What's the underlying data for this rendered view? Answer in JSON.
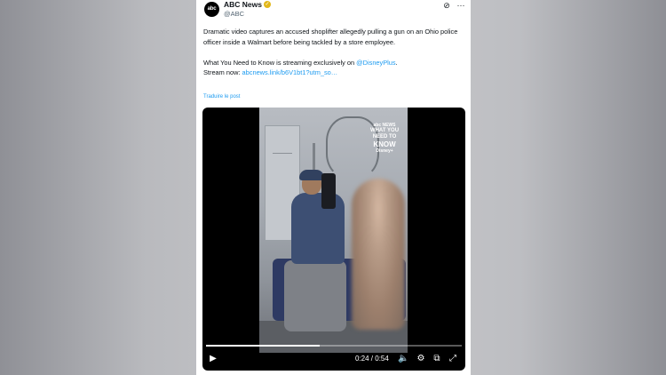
{
  "account": {
    "avatar_text": "abc",
    "avatar_sub": "NEWS",
    "name": "ABC News",
    "verified_glyph": "✓",
    "handle": "@ABC"
  },
  "header_icons": [
    "grok-icon",
    "more-icon"
  ],
  "tweet": {
    "line1": "Dramatic video captures an accused shoplifter allegedly pulling a gun on an Ohio police officer inside a Walmart before being tackled by a store employee.",
    "line2_prefix": "What You Need to Know is streaming exclusively on ",
    "line2_mention": "@DisneyPlus",
    "line2_suffix": ".",
    "line3_prefix": "Stream now: ",
    "line3_link": "abcnews.link/b6V1bt1?utm_so…",
    "translate": "Traduire le post"
  },
  "video": {
    "overlay_abc": "abc NEWS",
    "overlay_line1": "WHAT YOU",
    "overlay_line2": "NEED TO",
    "overlay_line3": "KNOW",
    "overlay_sub": "Disney+",
    "progress": 0.444,
    "current_time": "0:24",
    "duration": "0:54",
    "time_text": "0:24 / 0:54"
  },
  "colors": {
    "link": "#1d9bf0",
    "verified": "#e2b719",
    "text": "#0f1419",
    "muted": "#536471"
  }
}
